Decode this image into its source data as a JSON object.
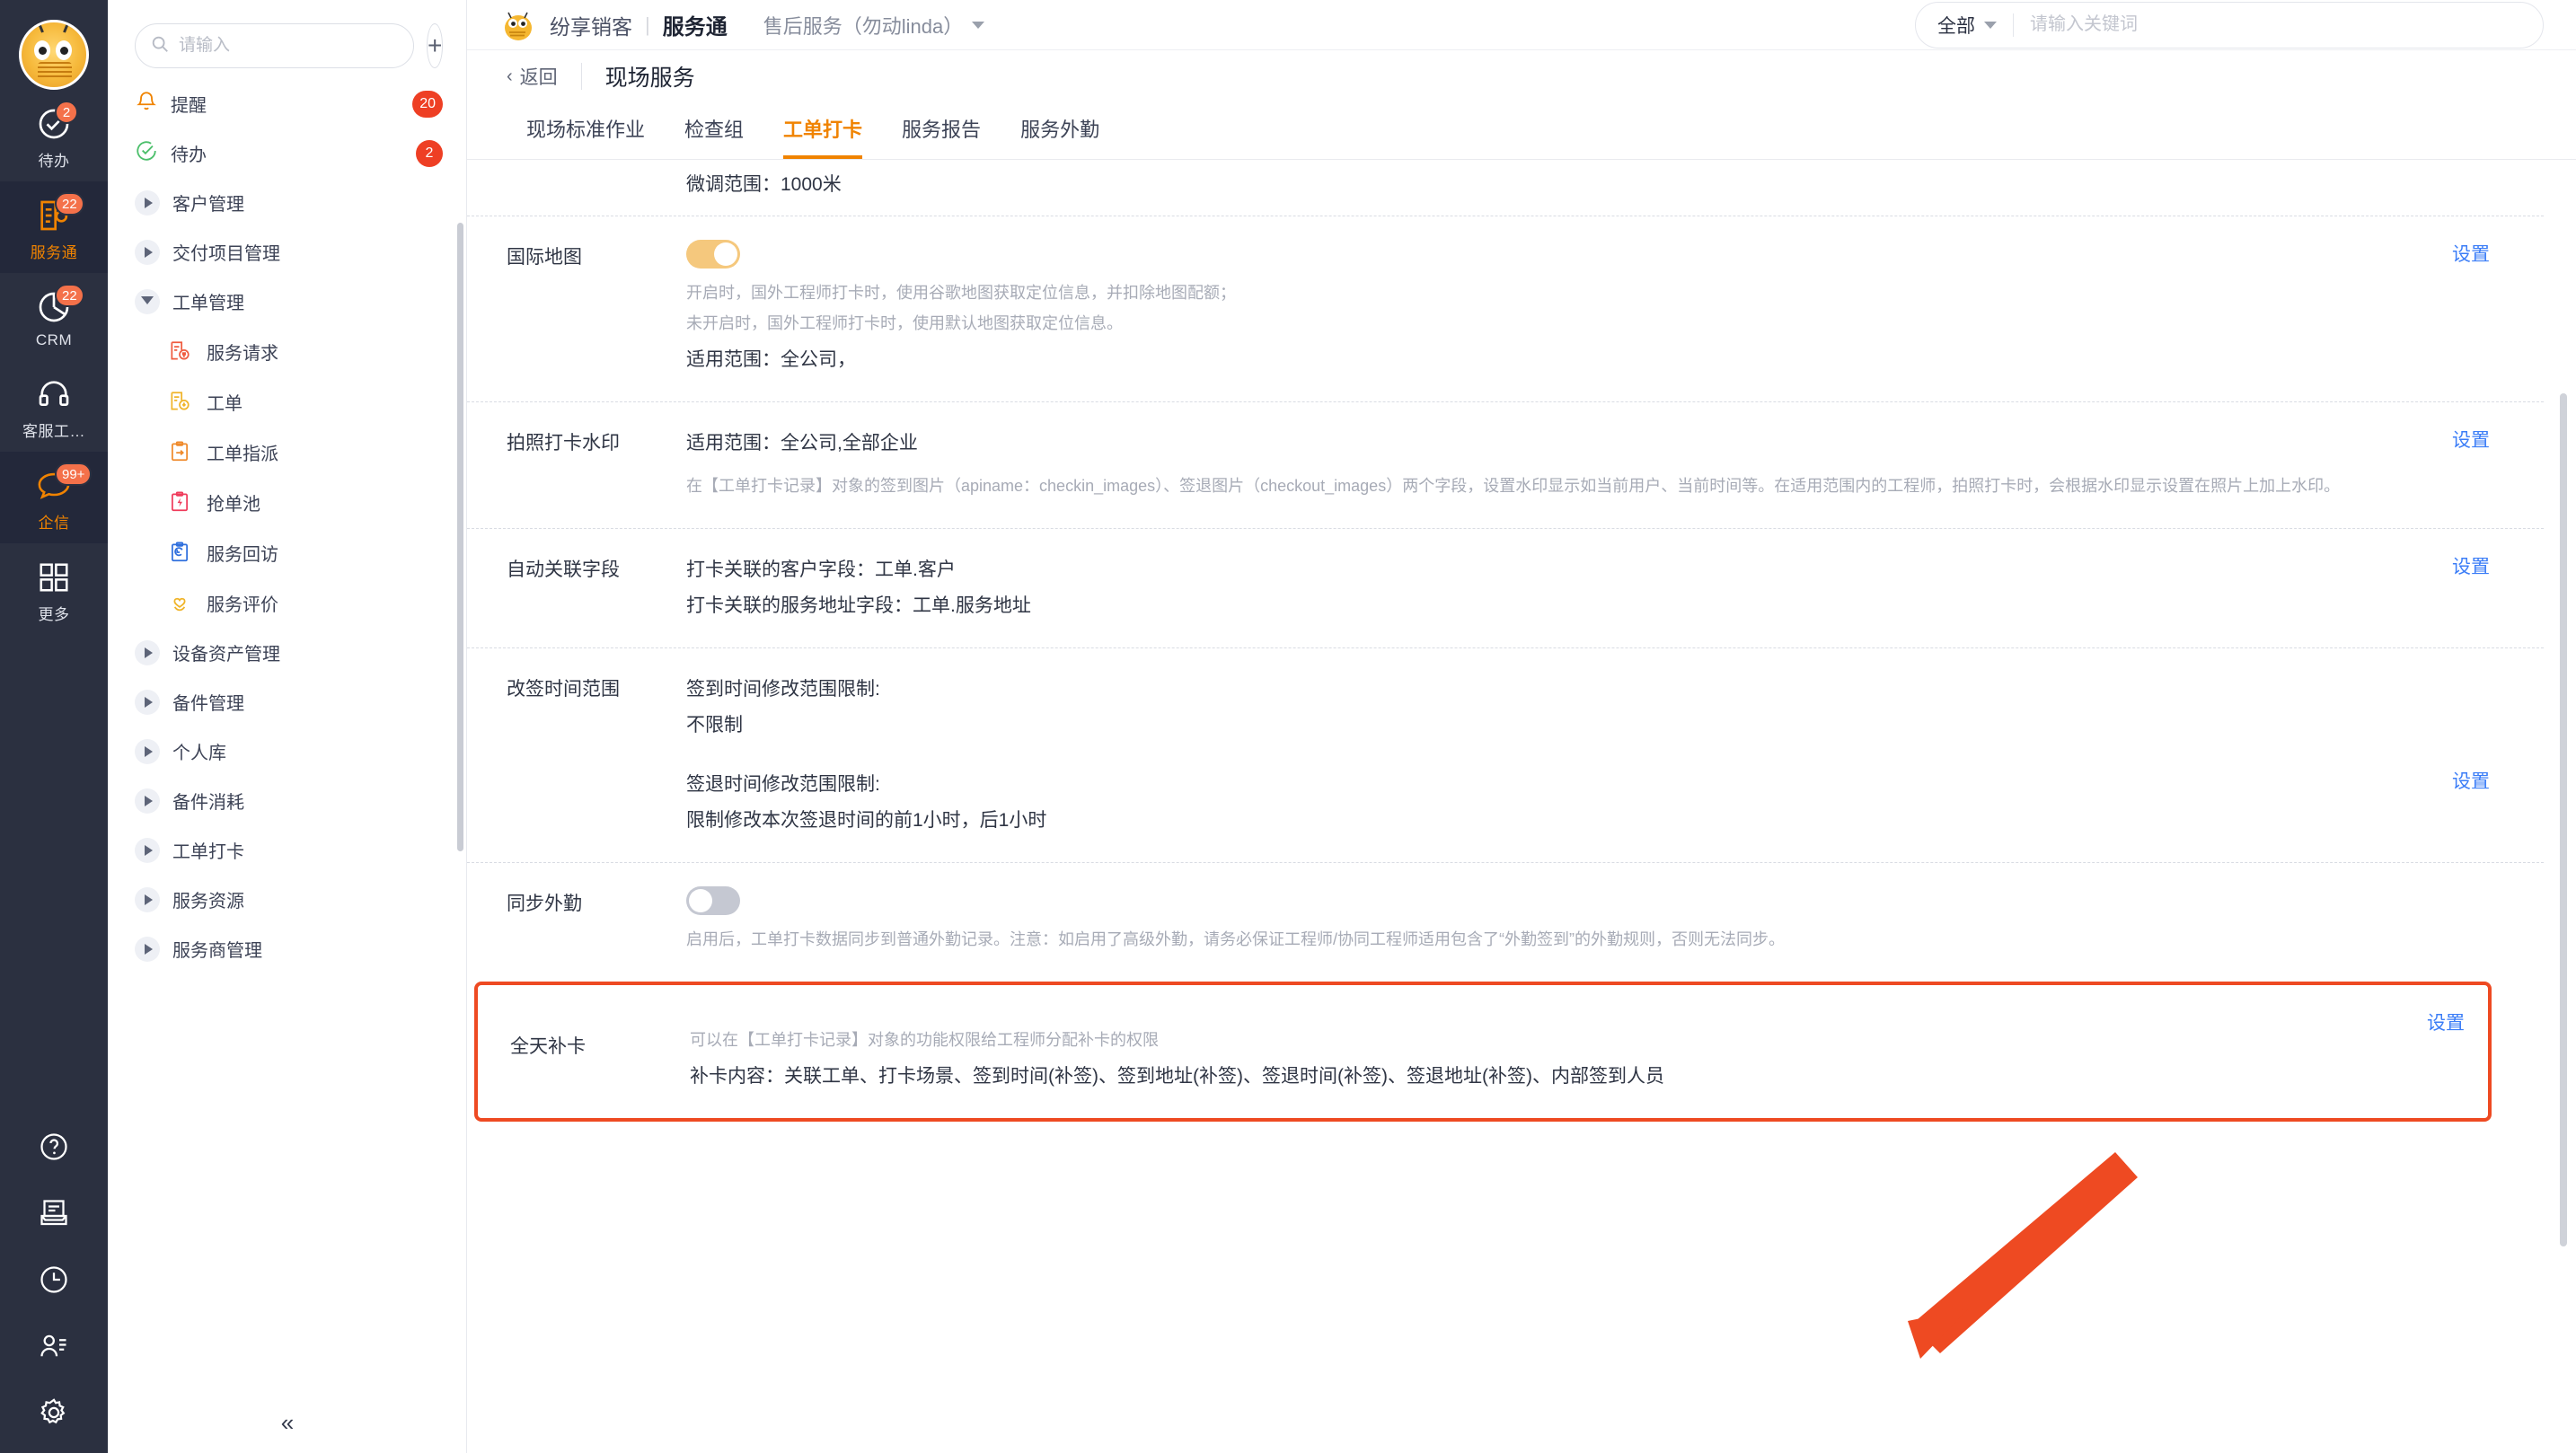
{
  "rail": {
    "avatar_name": "user-avatar",
    "items": [
      {
        "label": "待办",
        "badge": "2",
        "icon": "check-circle-icon",
        "active": false
      },
      {
        "label": "服务通",
        "badge": "22",
        "icon": "service-board-icon",
        "active": true
      },
      {
        "label": "CRM",
        "badge": "22",
        "icon": "pie-chart-icon",
        "active": false
      },
      {
        "label": "客服工…",
        "badge": "",
        "icon": "headset-icon",
        "active": false
      },
      {
        "label": "企信",
        "badge": "99+",
        "icon": "chat-bubble-icon",
        "active": true
      },
      {
        "label": "更多",
        "badge": "",
        "icon": "grid-icon",
        "active": false
      }
    ],
    "bottom_icons": [
      "help-circle-icon",
      "inbox-icon",
      "clock-icon",
      "contact-icon",
      "gear-icon"
    ]
  },
  "nav": {
    "search_placeholder": "请输入",
    "search_value": "",
    "add_label": "+",
    "items": [
      {
        "label": "提醒",
        "count": "20",
        "type": "leaf",
        "icon": "bell-icon"
      },
      {
        "label": "待办",
        "count": "2",
        "type": "leaf",
        "icon": "check-circle-icon"
      },
      {
        "label": "客户管理",
        "type": "group",
        "open": false
      },
      {
        "label": "交付项目管理",
        "type": "group",
        "open": false
      },
      {
        "label": "工单管理",
        "type": "group",
        "open": true
      },
      {
        "label": "服务请求",
        "type": "sub",
        "icon": "request-icon"
      },
      {
        "label": "工单",
        "type": "sub",
        "icon": "ticket-icon"
      },
      {
        "label": "工单指派",
        "type": "sub",
        "icon": "assign-icon"
      },
      {
        "label": "抢单池",
        "type": "sub",
        "icon": "grab-icon"
      },
      {
        "label": "服务回访",
        "type": "sub",
        "icon": "revisit-icon"
      },
      {
        "label": "服务评价",
        "type": "sub",
        "icon": "heart-icon"
      },
      {
        "label": "设备资产管理",
        "type": "group",
        "open": false
      },
      {
        "label": "备件管理",
        "type": "group",
        "open": false
      },
      {
        "label": "个人库",
        "type": "group",
        "open": false
      },
      {
        "label": "备件消耗",
        "type": "group",
        "open": false
      },
      {
        "label": "工单打卡",
        "type": "group",
        "open": false
      },
      {
        "label": "服务资源",
        "type": "group",
        "open": false
      },
      {
        "label": "服务商管理",
        "type": "group",
        "open": false
      }
    ],
    "collapse_label": "«"
  },
  "topbar": {
    "brand": "纷享销客",
    "separator": "|",
    "product": "服务通",
    "app_switcher": "售后服务（勿动linda）",
    "search_scope": "全部",
    "search_placeholder": "请输入关键词",
    "search_value": ""
  },
  "page": {
    "back_label": "返回",
    "title": "现场服务",
    "tabs": [
      {
        "label": "现场标准作业",
        "active": false
      },
      {
        "label": "检查组",
        "active": false
      },
      {
        "label": "工单打卡",
        "active": true
      },
      {
        "label": "服务报告",
        "active": false
      },
      {
        "label": "服务外勤",
        "active": false
      }
    ]
  },
  "settings_label": "设置",
  "rows": [
    {
      "partial": true,
      "label": "",
      "value": "微调范围：1000米"
    },
    {
      "label": "国际地图",
      "toggle": "on",
      "desc": "开启时，国外工程师打卡时，使用谷歌地图获取定位信息，并扣除地图配额；\n未开启时，国外工程师打卡时，使用默认地图获取定位信息。",
      "value": "适用范围：全公司，",
      "action": "设置"
    },
    {
      "label": "拍照打卡水印",
      "value": "适用范围：全公司,全部企业",
      "desc": "在【工单打卡记录】对象的签到图片（apiname：checkin_images）、签退图片（checkout_images）两个字段，设置水印显示如当前用户、当前时间等。在适用范围内的工程师，拍照打卡时，会根据水印显示设置在照片上加上水印。",
      "action": "设置"
    },
    {
      "label": "自动关联字段",
      "lines": [
        "打卡关联的客户字段：工单.客户",
        "打卡关联的服务地址字段：工单.服务地址"
      ],
      "action": "设置"
    },
    {
      "label": "改签时间范围",
      "lines": [
        "签到时间修改范围限制:",
        "不限制",
        "",
        "签退时间修改范围限制:",
        "限制修改本次签退时间的前1小时，后1小时"
      ],
      "action": "设置"
    },
    {
      "label": "同步外勤",
      "toggle": "off",
      "desc": "启用后，工单打卡数据同步到普通外勤记录。注意：如启用了高级外勤，请务必保证工程师/协同工程师适用包含了“外勤签到”的外勤规则，否则无法同步。"
    },
    {
      "label": "全天补卡",
      "highlight": true,
      "desc": "可以在【工单打卡记录】对象的功能权限给工程师分配补卡的权限",
      "value": "补卡内容：关联工单、打卡场景、签到时间(补签)、签到地址(补签)、签退时间(补签)、签退地址(补签)、内部签到人员",
      "action": "设置"
    }
  ],
  "annotation": {
    "type": "arrow",
    "color": "#ee4a22",
    "target": "全天补卡"
  },
  "colors": {
    "accent_orange": "#f08300",
    "link_blue": "#3b7df7",
    "badge_red": "#ee3f24",
    "highlight_red": "#ee4a22",
    "rail_bg": "#2b3040"
  }
}
